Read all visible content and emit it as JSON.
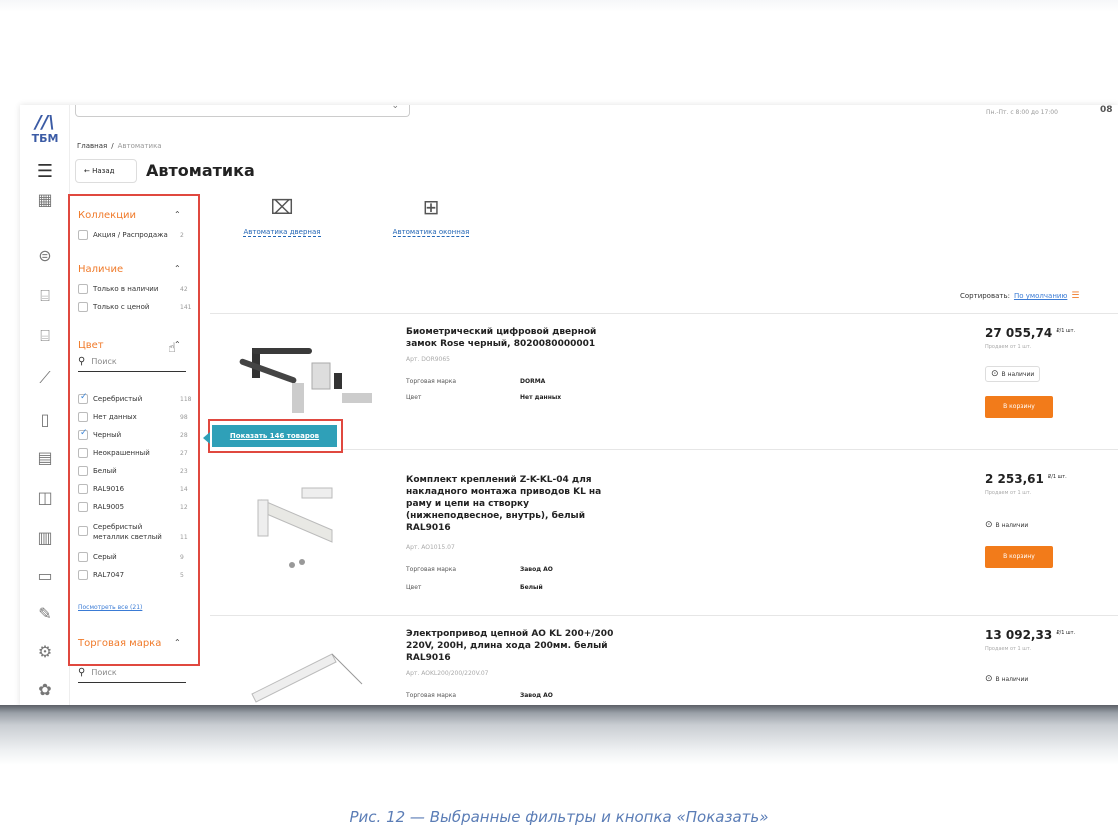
{
  "breadcrumb": {
    "home": "Главная",
    "separator": "/",
    "current": "Автоматика"
  },
  "header": {
    "back_label": "← Назад",
    "title": "Автоматика",
    "hours": "Пн.-Пт. с 8:00 до 17:00",
    "hours_extra": "08"
  },
  "logo": {
    "text": "ТБМ"
  },
  "categories": [
    {
      "label": "Автоматика дверная",
      "icon": "door-icon"
    },
    {
      "label": "Автоматика оконная",
      "icon": "window-icon"
    }
  ],
  "filters": {
    "collections": {
      "title": "Коллекции",
      "items": [
        {
          "label": "Акция / Распродажа",
          "count": "2",
          "checked": false
        }
      ]
    },
    "availability": {
      "title": "Наличие",
      "items": [
        {
          "label": "Только в наличии",
          "count": "42",
          "checked": false
        },
        {
          "label": "Только с ценой",
          "count": "141",
          "checked": false
        }
      ]
    },
    "color": {
      "title": "Цвет",
      "search_placeholder": "Поиск",
      "items": [
        {
          "label": "Серебристый",
          "count": "118",
          "checked": true
        },
        {
          "label": "Нет данных",
          "count": "98",
          "checked": false
        },
        {
          "label": "Черный",
          "count": "28",
          "checked": true
        },
        {
          "label": "Неокрашенный",
          "count": "27",
          "checked": false
        },
        {
          "label": "Белый",
          "count": "23",
          "checked": false
        },
        {
          "label": "RAL9016",
          "count": "14",
          "checked": false
        },
        {
          "label": "RAL9005",
          "count": "12",
          "checked": false
        },
        {
          "label": "Серебристый металлик светлый",
          "count": "11",
          "checked": false
        },
        {
          "label": "Серый",
          "count": "9",
          "checked": false
        },
        {
          "label": "RAL7047",
          "count": "5",
          "checked": false
        }
      ],
      "view_all": "Посмотреть все (21)"
    },
    "brand": {
      "title": "Торговая марка",
      "search_placeholder": "Поиск"
    }
  },
  "show_button": {
    "label": "Показать 146 товаров"
  },
  "sort": {
    "label": "Сортировать:",
    "value": "По умолчанию"
  },
  "products": [
    {
      "name": "Биометрический цифровой дверной замок Rose черный, 8020080000001",
      "article": "Арт. DOR9065",
      "brand_key": "Торговая марка",
      "brand_val": "DORMA",
      "color_key": "Цвет",
      "color_val": "Нет данных",
      "price": "27 055,74",
      "unit": "₽/1 шт.",
      "sub": "Продаем от 1 шт.",
      "stock": "В наличии",
      "cart": "В корзину"
    },
    {
      "name": "Комплект креплений Z-K-KL-04 для накладного монтажа приводов KL на раму и цепи на створку (нижнеподвесное, внутрь), белый RAL9016",
      "article": "Арт. AO1015.07",
      "brand_key": "Торговая марка",
      "brand_val": "Завод АО",
      "color_key": "Цвет",
      "color_val": "Белый",
      "price": "2 253,61",
      "unit": "₽/1 шт.",
      "sub": "Продаем от 1 шт.",
      "stock": "В наличии",
      "cart": "В корзину"
    },
    {
      "name": "Электропривод цепной АО KL 200+/200 220V, 200Н, длина хода 200мм. белый RAL9016",
      "article": "Арт. AOKL200/200/220V.07",
      "brand_key": "Торговая марка",
      "brand_val": "Завод АО",
      "price": "13 092,33",
      "unit": "₽/1 шт.",
      "sub": "Продаем от 1 шт.",
      "stock": "В наличии"
    }
  ],
  "caption": "Рис. 12 — Выбранные фильтры и кнопка «Показать»"
}
